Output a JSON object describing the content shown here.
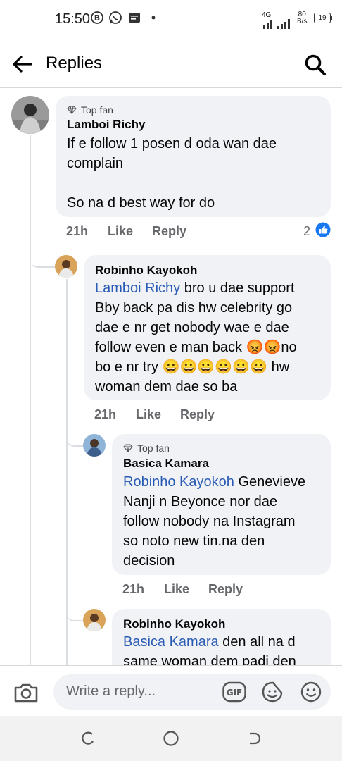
{
  "status_bar": {
    "time": "15:50",
    "network": "4G",
    "speed_value": "80",
    "speed_unit": "B/s",
    "battery": "19"
  },
  "header": {
    "title": "Replies"
  },
  "comments": [
    {
      "badge": "Top fan",
      "author": "Lamboi Richy",
      "mention": "",
      "text": "If e follow 1 posen d oda wan dae\ncomplain\n\nSo na d best way for do",
      "time": "21h",
      "like": "Like",
      "reply": "Reply",
      "reactions": "2"
    },
    {
      "author": "Robinho Kayokoh",
      "mention": "Lamboi Richy",
      "text_line1": " bro u dae support",
      "text_rest": "Bby back pa dis hw celebrity go\ndae e nr get nobody wae e dae\nfollow even e man back ",
      "text_mid": "no\nbo e nr try ",
      "text_end": " hw\nwoman dem dae so ba",
      "emoji_angry": "😡😡",
      "emoji_grin": "😀😀😀😀😀😀",
      "time": "21h",
      "like": "Like",
      "reply": "Reply"
    },
    {
      "badge": "Top fan",
      "author": "Basica Kamara",
      "mention": "Robinho Kayokoh",
      "text_line1": " Genevieve",
      "text_rest": "Nanji n Beyonce nor dae\nfollow nobody na Instagram\nso noto new tin.na den\ndecision",
      "time": "21h",
      "like": "Like",
      "reply": "Reply"
    },
    {
      "author": "Robinho Kayokoh",
      "mention": "Basica Kamara",
      "text_line1": " den all na d",
      "text_rest": "same woman dem padi den"
    }
  ],
  "composer": {
    "placeholder": "Write a reply...",
    "gif_label": "GIF"
  },
  "colors": {
    "bubble": "#f0f2f5",
    "mention": "#2a5bb4",
    "like_blue": "#1877f2",
    "meta": "#65676b"
  }
}
